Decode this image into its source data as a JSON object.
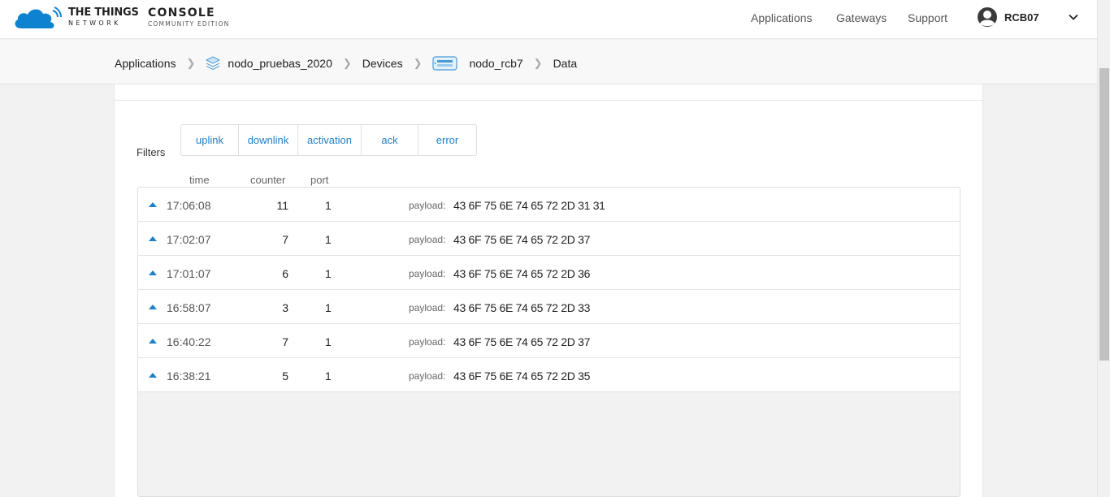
{
  "brand": {
    "line1": "THE THINGS",
    "line2": "NETWORK",
    "console": "CONSOLE",
    "edition": "COMMUNITY EDITION"
  },
  "nav": {
    "applications": "Applications",
    "gateways": "Gateways",
    "support": "Support",
    "username": "RCB07"
  },
  "breadcrumb": {
    "applications": "Applications",
    "app": "nodo_pruebas_2020",
    "devices": "Devices",
    "device": "nodo_rcb7",
    "data": "Data"
  },
  "filters": {
    "label": "Filters",
    "items": [
      "uplink",
      "downlink",
      "activation",
      "ack",
      "error"
    ]
  },
  "columns": {
    "time": "time",
    "counter": "counter",
    "port": "port"
  },
  "payload_label": "payload:",
  "rows": [
    {
      "time": "17:06:08",
      "counter": "11",
      "port": "1",
      "payload": "43 6F 75 6E 74 65 72 2D 31 31"
    },
    {
      "time": "17:02:07",
      "counter": "7",
      "port": "1",
      "payload": "43 6F 75 6E 74 65 72 2D 37"
    },
    {
      "time": "17:01:07",
      "counter": "6",
      "port": "1",
      "payload": "43 6F 75 6E 74 65 72 2D 36"
    },
    {
      "time": "16:58:07",
      "counter": "3",
      "port": "1",
      "payload": "43 6F 75 6E 74 65 72 2D 33"
    },
    {
      "time": "16:40:22",
      "counter": "7",
      "port": "1",
      "payload": "43 6F 75 6E 74 65 72 2D 37"
    },
    {
      "time": "16:38:21",
      "counter": "5",
      "port": "1",
      "payload": "43 6F 75 6E 74 65 72 2D 35"
    }
  ],
  "colors": {
    "accent": "#1f7fc4",
    "logo": "#0d83d0"
  }
}
